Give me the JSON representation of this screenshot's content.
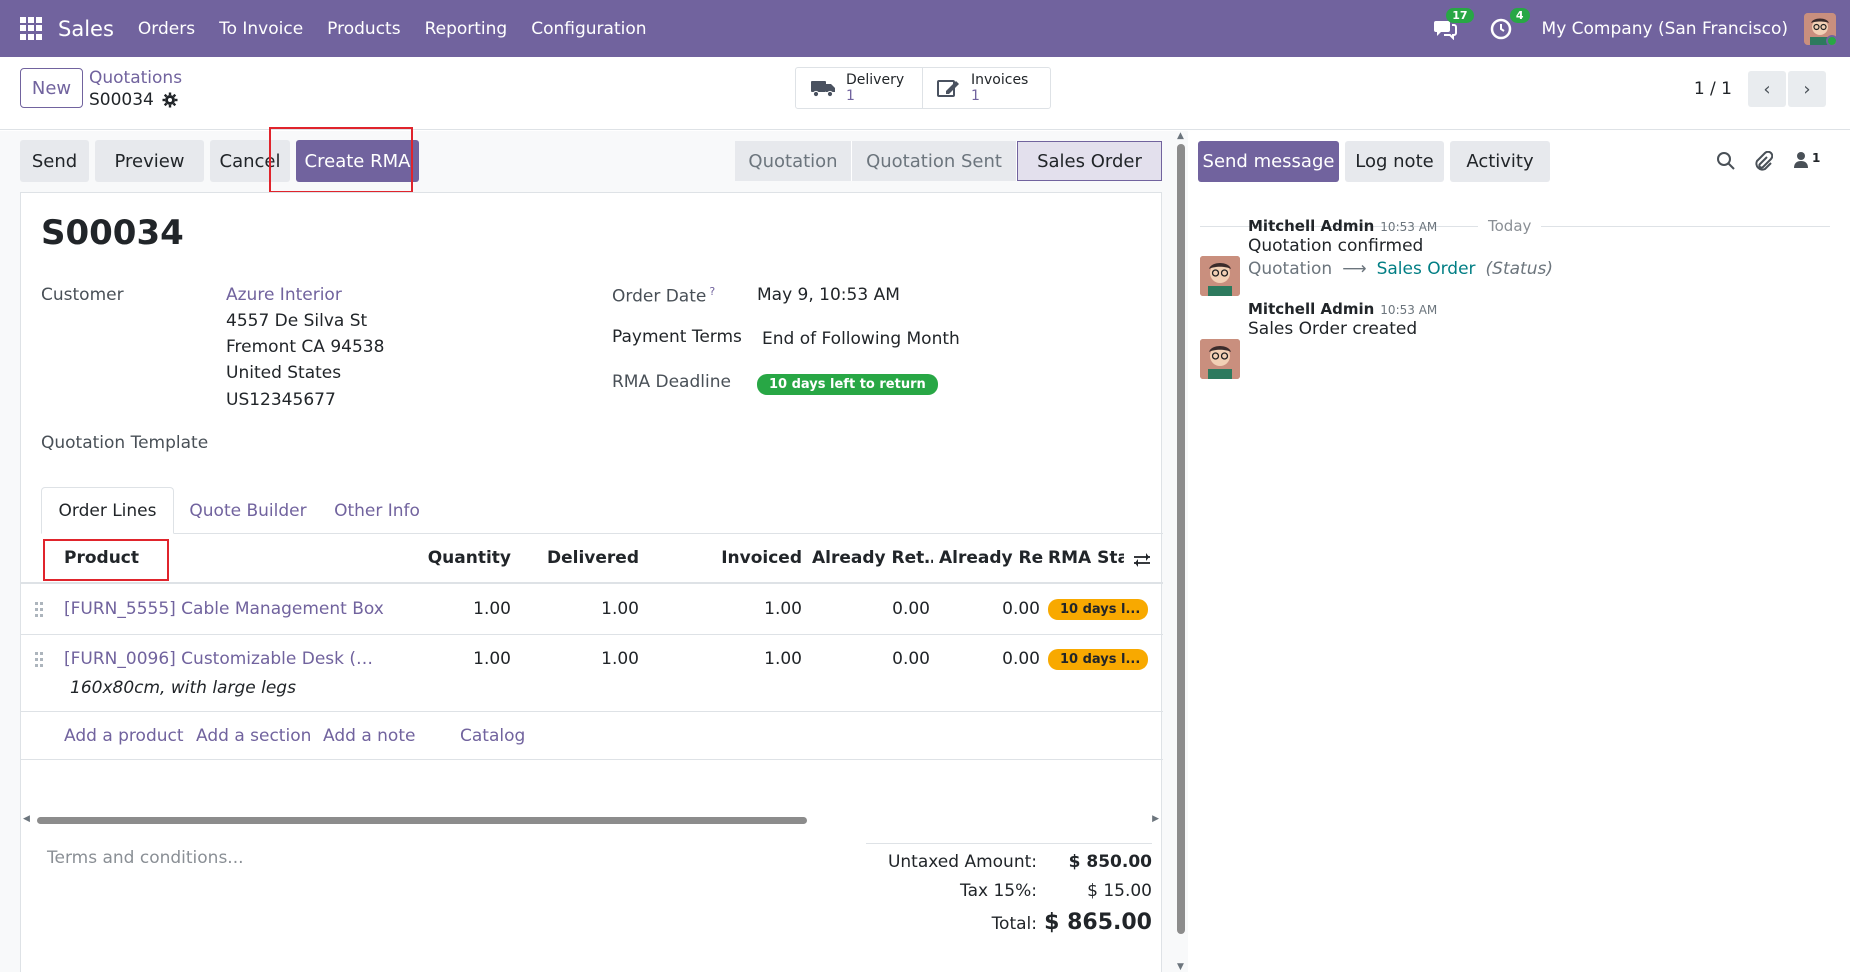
{
  "navbar": {
    "app_name": "Sales",
    "menu": [
      "Orders",
      "To Invoice",
      "Products",
      "Reporting",
      "Configuration"
    ],
    "messages_count": "17",
    "activities_count": "4",
    "company": "My Company (San Francisco)"
  },
  "control": {
    "new_label": "New",
    "breadcrumb_parent": "Quotations",
    "breadcrumb_current": "S00034",
    "smart_buttons": [
      {
        "label": "Delivery",
        "count": "1",
        "icon": "truck-icon"
      },
      {
        "label": "Invoices",
        "count": "1",
        "icon": "invoice-icon"
      }
    ],
    "pager": "1 / 1"
  },
  "actions": {
    "send": "Send",
    "preview": "Preview",
    "cancel": "Cancel",
    "create_rma": "Create RMA"
  },
  "stages": [
    "Quotation",
    "Quotation Sent",
    "Sales Order"
  ],
  "stage_active": "Sales Order",
  "form": {
    "title": "S00034",
    "customer_label": "Customer",
    "customer_name": "Azure Interior",
    "customer_address": [
      "4557 De Silva St",
      "Fremont CA 94538",
      "United States",
      "US12345677"
    ],
    "quotation_template_label": "Quotation Template",
    "order_date_label": "Order Date",
    "order_date_help": "?",
    "order_date": "May 9, 10:53 AM",
    "payment_terms_label": "Payment Terms",
    "payment_terms": "End of Following Month",
    "rma_deadline_label": "RMA Deadline",
    "rma_deadline": "10 days left to return"
  },
  "tabs": [
    "Order Lines",
    "Quote Builder",
    "Other Info"
  ],
  "table": {
    "headers": {
      "product": "Product",
      "quantity": "Quantity",
      "delivered": "Delivered",
      "invoiced": "Invoiced",
      "already_returned": "Already Ret…",
      "already_received": "Already Re…",
      "rma_status": "RMA Stat"
    },
    "rows": [
      {
        "product": "[FURN_5555] Cable Management Box",
        "description": "",
        "quantity": "1.00",
        "delivered": "1.00",
        "invoiced": "1.00",
        "already_returned": "0.00",
        "already_received": "0.00",
        "rma_status": "10 days l..."
      },
      {
        "product": "[FURN_0096] Customizable Desk (…",
        "description": "160x80cm, with large legs",
        "quantity": "1.00",
        "delivered": "1.00",
        "invoiced": "1.00",
        "already_returned": "0.00",
        "already_received": "0.00",
        "rma_status": "10 days l..."
      }
    ],
    "add_links": [
      "Add a product",
      "Add a section",
      "Add a note",
      "Catalog"
    ]
  },
  "footer": {
    "terms_placeholder": "Terms and conditions...",
    "untaxed_label": "Untaxed Amount:",
    "untaxed_value": "$ 850.00",
    "tax_label": "Tax 15%:",
    "tax_value": "$ 15.00",
    "total_label": "Total:",
    "total_value": "$ 865.00"
  },
  "chatter": {
    "send_message": "Send message",
    "log_note": "Log note",
    "activity": "Activity",
    "followers_count": "1",
    "date_separator": "Today",
    "messages": [
      {
        "author": "Mitchell Admin",
        "time": "10:53 AM",
        "body": "Quotation confirmed",
        "tracking_old": "Quotation",
        "tracking_new": "Sales Order",
        "tracking_field": "(Status)"
      },
      {
        "author": "Mitchell Admin",
        "time": "10:53 AM",
        "body": "Sales Order created"
      }
    ]
  },
  "colors": {
    "brand": "#71639e",
    "success": "#28a745",
    "warning": "#f8a900",
    "highlight_box": "#e0242c"
  }
}
